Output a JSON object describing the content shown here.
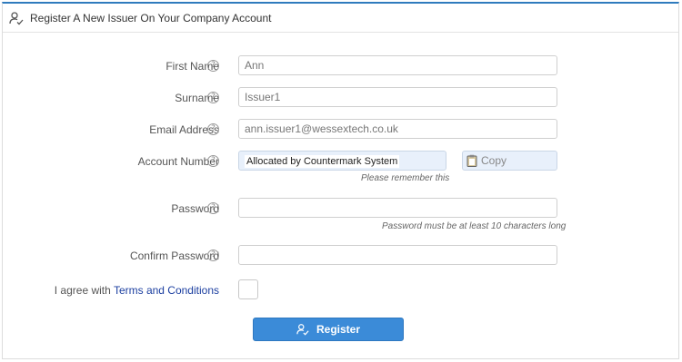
{
  "header": {
    "title": "Register A New Issuer On Your Company Account",
    "icon": "user-check-icon"
  },
  "fields": {
    "first_name": {
      "label": "First Name",
      "value": "Ann"
    },
    "surname": {
      "label": "Surname",
      "value": "Issuer1"
    },
    "email": {
      "label": "Email Address",
      "value": "ann.issuer1@wessextech.co.uk"
    },
    "account_number": {
      "label": "Account Number",
      "value": "Allocated by Countermark System",
      "hint": "Please remember this",
      "copy_label": "Copy"
    },
    "password": {
      "label": "Password",
      "value": "",
      "hint": "Password must be at least 10 characters long"
    },
    "confirm_password": {
      "label": "Confirm Password",
      "value": ""
    }
  },
  "help_glyph": "?",
  "agree": {
    "prefix": "I agree with",
    "link": "Terms and Conditions"
  },
  "register_button": {
    "label": "Register"
  },
  "colors": {
    "accent": "#2f7bbd",
    "button": "#3b8bd8",
    "link": "#1c3fa0",
    "readonly_bg": "#e8f0fb"
  }
}
